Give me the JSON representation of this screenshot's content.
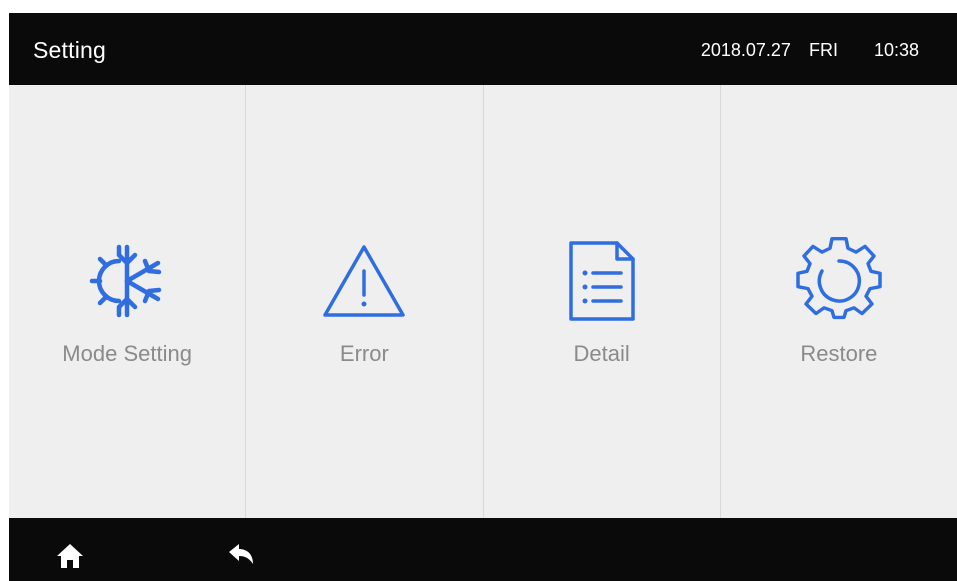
{
  "header": {
    "title": "Setting",
    "date": "2018.07.27",
    "day": "FRI",
    "time": "10:38"
  },
  "tiles": [
    {
      "label": "Mode Setting",
      "icon": "snowflake-sun-icon"
    },
    {
      "label": "Error",
      "icon": "warning-triangle-icon"
    },
    {
      "label": "Detail",
      "icon": "document-list-icon"
    },
    {
      "label": "Restore",
      "icon": "gear-icon"
    }
  ],
  "footer": {
    "home_icon": "home-icon",
    "back_icon": "back-arrow-icon"
  },
  "colors": {
    "bar_background": "#0a0a0a",
    "panel_background": "#efefef",
    "icon_blue": "#2f6de1",
    "label_gray": "#8a8a8a",
    "header_text": "#ffffff"
  }
}
